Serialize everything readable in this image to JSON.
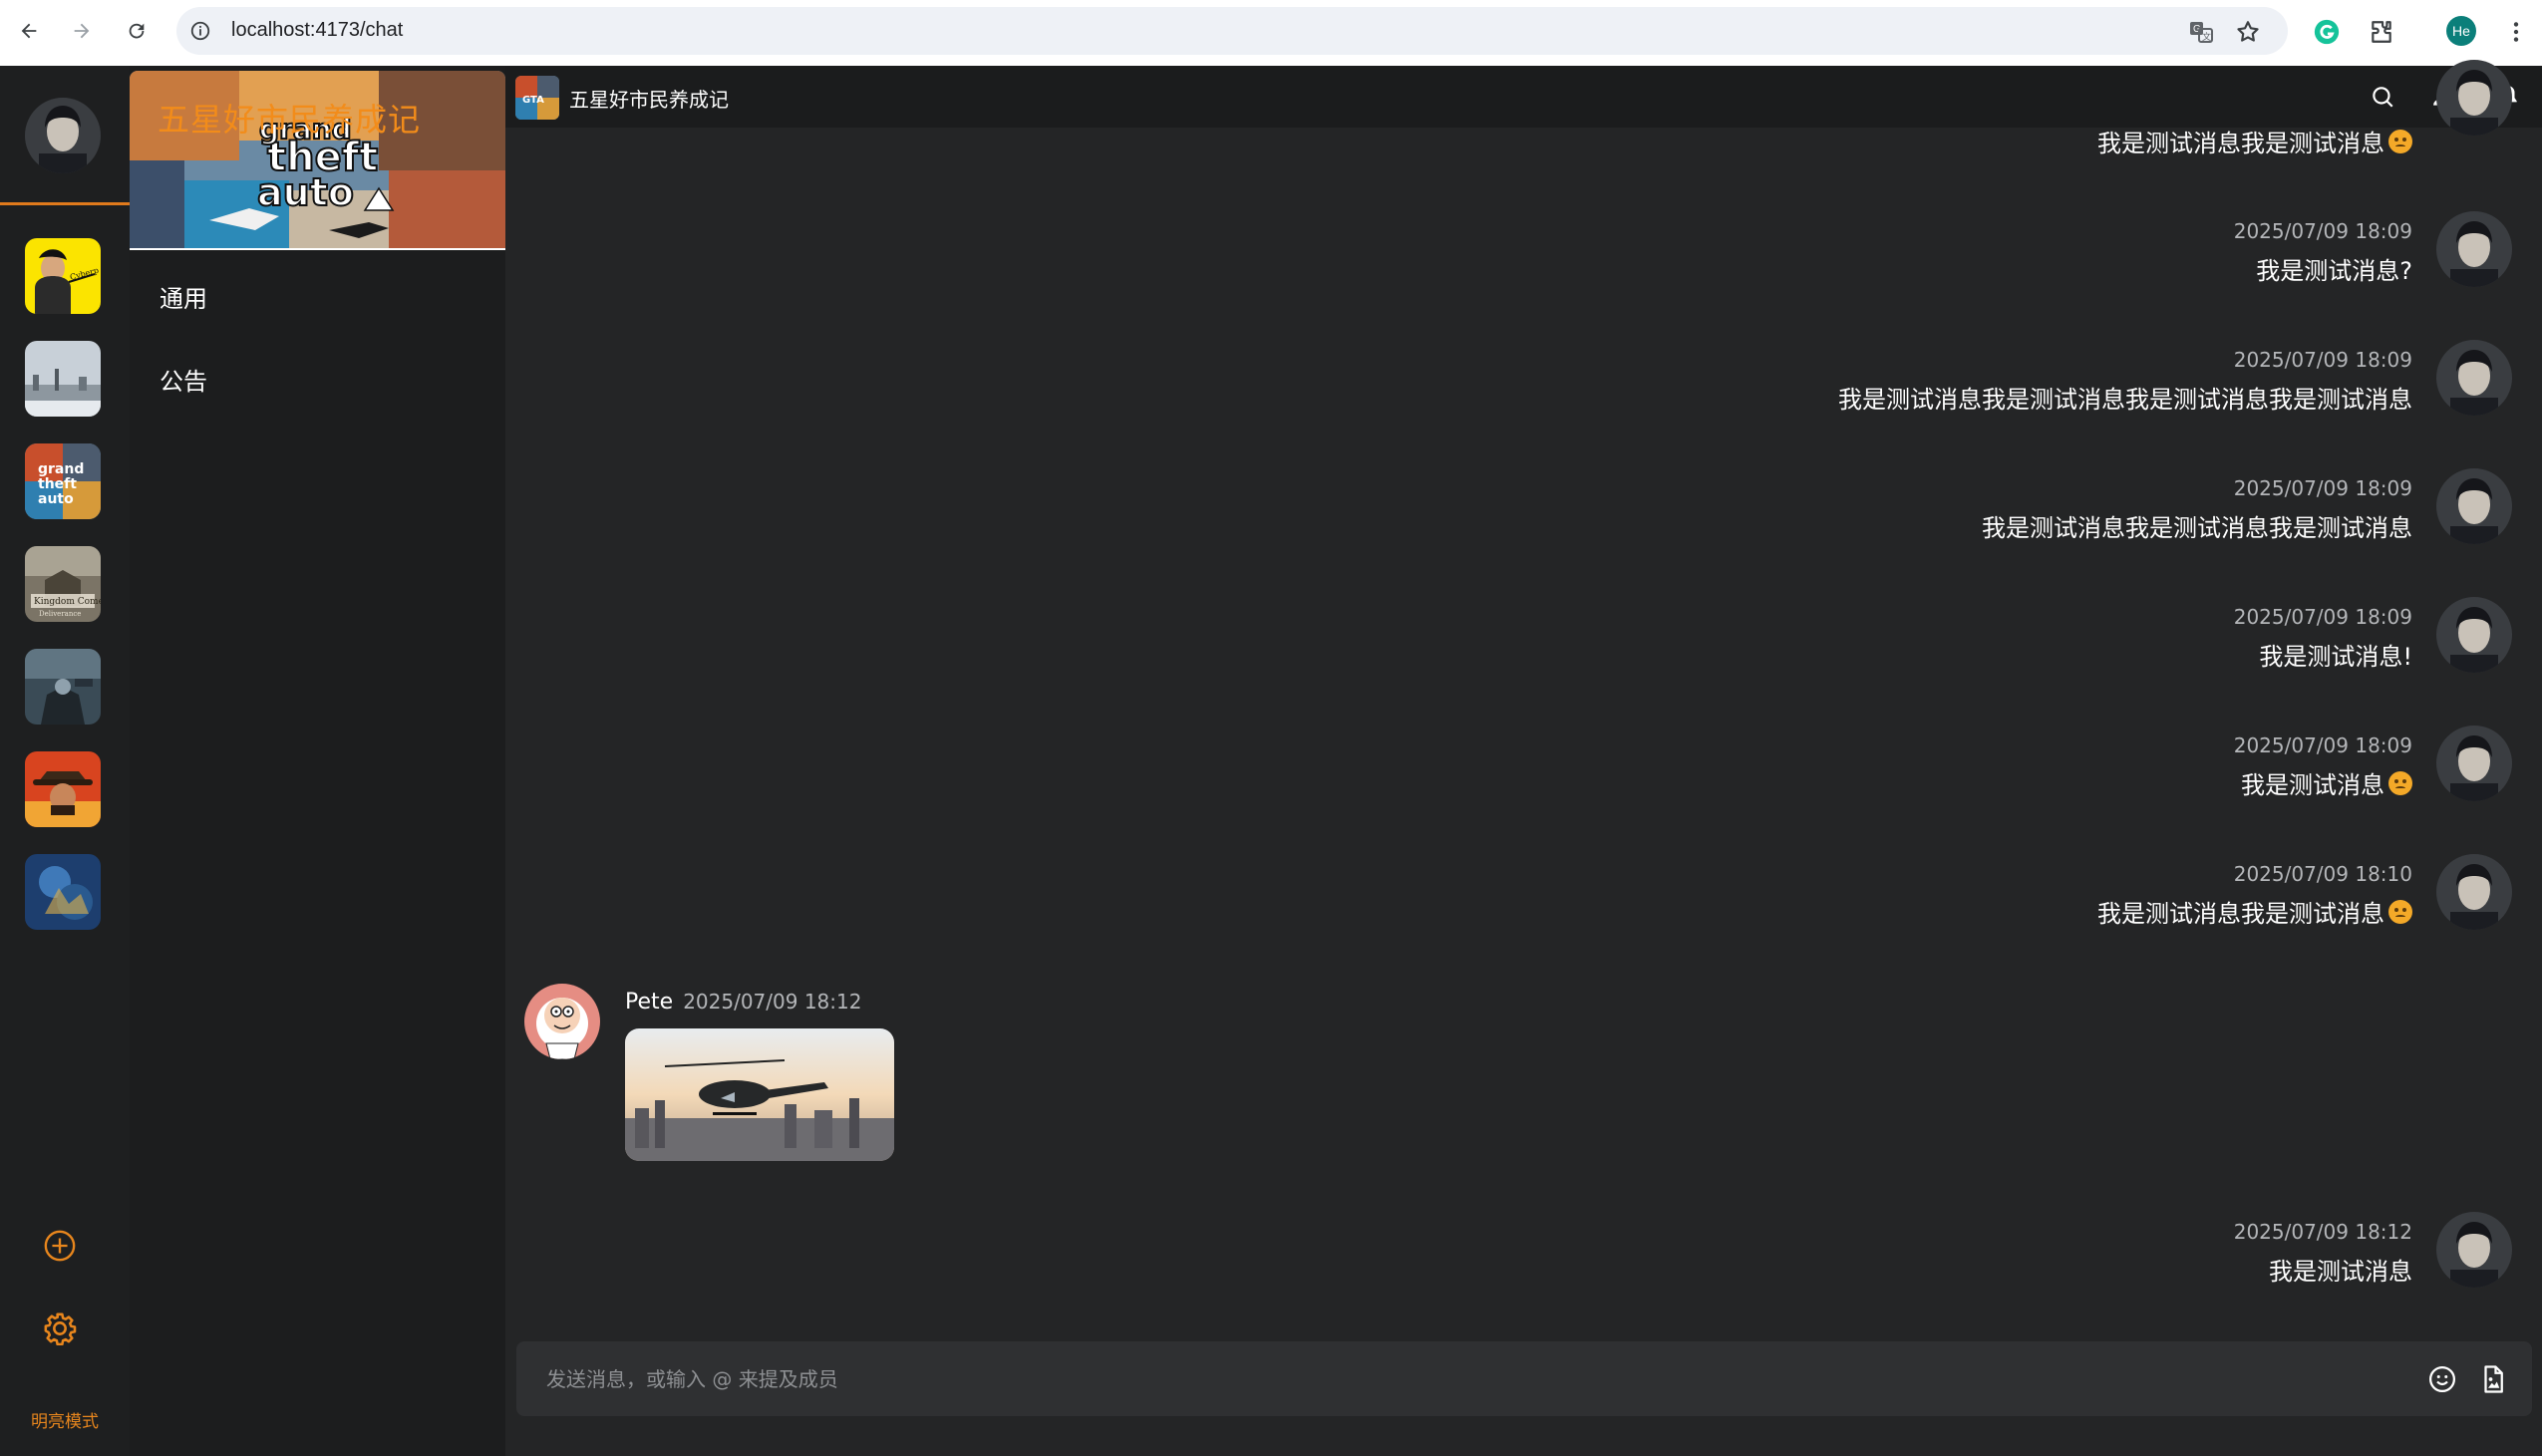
{
  "browser": {
    "url": "localhost:4173/chat",
    "profile_initials": "He",
    "icons": [
      "back-icon",
      "forward-icon",
      "reload-icon",
      "site-info-icon",
      "translate-icon",
      "bookmark-star-icon",
      "grammarly-icon",
      "extensions-icon",
      "menu-kebab-icon"
    ]
  },
  "rail": {
    "mode_toggle": "明亮模式",
    "servers": [
      "cyberpunk",
      "snowy-city",
      "gta5",
      "kingdom-come-deliverance",
      "mech-warrior",
      "red-dead-redemption",
      "fantasy-battle"
    ],
    "actions": [
      "add-server-icon",
      "settings-icon"
    ],
    "accent": "#e8861d"
  },
  "channel_panel": {
    "banner_title": "五星好市民养成记",
    "channels": [
      "通用",
      "公告"
    ]
  },
  "header": {
    "title": "五星好市民养成记",
    "icons": [
      "search-icon",
      "members-icon",
      "bell-icon"
    ]
  },
  "messages": [
    {
      "time": "",
      "text": "我是测试消息我是测试消息",
      "emoji": true,
      "self": true
    },
    {
      "time": "2025/07/09 18:09",
      "text": "我是测试消息?",
      "emoji": false,
      "self": true
    },
    {
      "time": "2025/07/09 18:09",
      "text": "我是测试消息我是测试消息我是测试消息我是测试消息",
      "emoji": false,
      "self": true
    },
    {
      "time": "2025/07/09 18:09",
      "text": "我是测试消息我是测试消息我是测试消息",
      "emoji": false,
      "self": true
    },
    {
      "time": "2025/07/09 18:09",
      "text": "我是测试消息!",
      "emoji": false,
      "self": true
    },
    {
      "time": "2025/07/09 18:09",
      "text": "我是测试消息",
      "emoji": true,
      "self": true
    },
    {
      "time": "2025/07/09 18:10",
      "text": "我是测试消息我是测试消息",
      "emoji": true,
      "self": true
    },
    {
      "author": "Pete",
      "time": "2025/07/09 18:12",
      "image": "helicopter-over-city",
      "self": false
    },
    {
      "time": "2025/07/09 18:12",
      "text": "我是测试消息",
      "emoji": false,
      "self": true
    }
  ],
  "composer": {
    "placeholder": "发送消息，或输入 @ 来提及成员",
    "icons": [
      "emoji-picker-icon",
      "attach-file-icon"
    ]
  }
}
